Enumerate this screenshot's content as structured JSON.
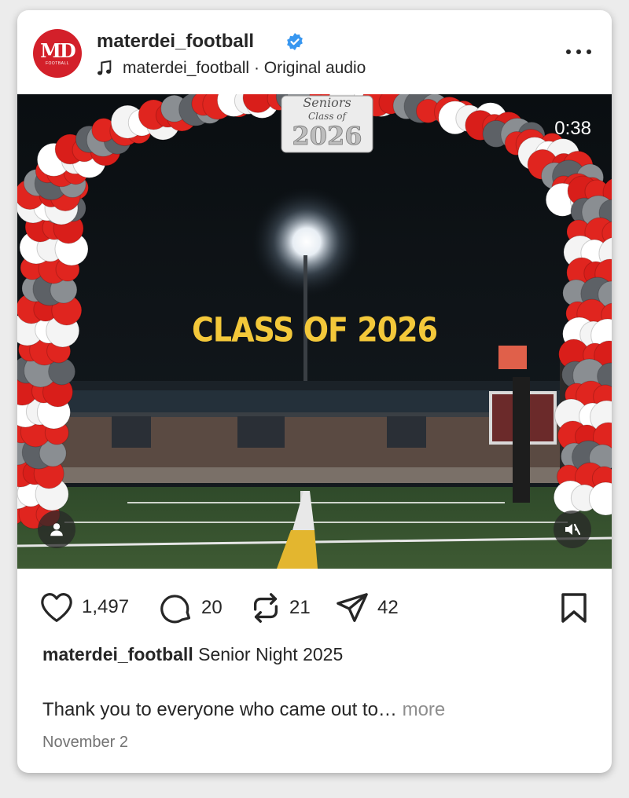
{
  "post": {
    "username": "materdei_football",
    "avatar_monogram": "MD",
    "avatar_subtext": "FOOTBALL",
    "audio_owner": "materdei_football",
    "audio_separator": " · ",
    "audio_label": "Original audio",
    "duration": "0:38",
    "overlay_text": "CLASS OF 2026",
    "sign_line1": "Seniors",
    "sign_line2": "Class of",
    "sign_line3": "2026",
    "likes": "1,497",
    "comments": "20",
    "reposts": "21",
    "shares": "42",
    "caption_user": "materdei_football",
    "caption_text": " Senior Night 2025",
    "caption_body": "Thank you to everyone who came out to…",
    "caption_more": " more",
    "date": "November 2"
  },
  "colors": {
    "accent_red": "#d3202a",
    "verified_blue": "#3897f0",
    "overlay_yellow": "#f3c83a"
  },
  "icons": [
    "music-note-icon",
    "verified-badge-icon",
    "more-options-icon",
    "user-tag-icon",
    "mute-icon",
    "heart-icon",
    "comment-icon",
    "repost-icon",
    "share-icon",
    "bookmark-icon"
  ]
}
